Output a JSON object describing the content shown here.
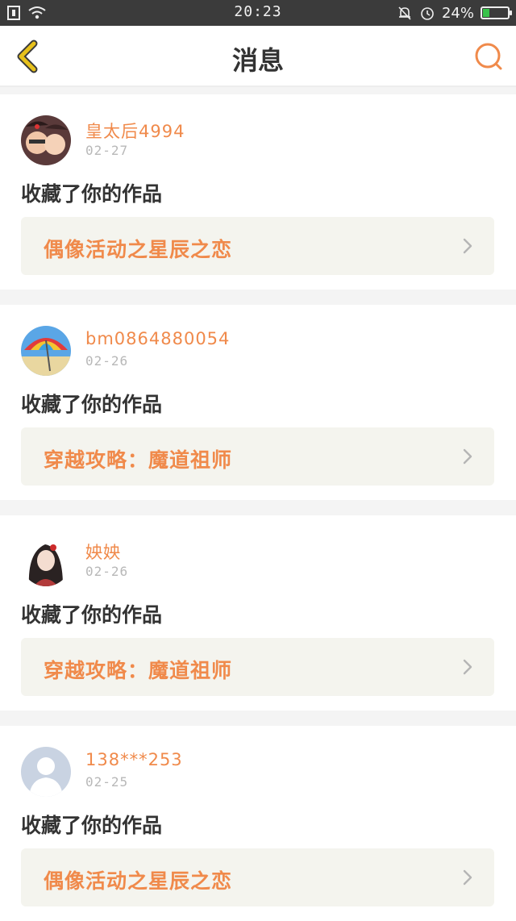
{
  "status_bar": {
    "time": "20:23",
    "battery_text": "24%",
    "battery_level": 0.24
  },
  "header": {
    "title": "消息",
    "back_icon": "chevron-left-icon",
    "search_icon": "search-icon"
  },
  "colors": {
    "accent": "#f08a4b",
    "back_icon": "#e7c11b",
    "card_bg": "#ffffff",
    "work_bg": "#f4f4ee",
    "page_bg": "#f4f4f4"
  },
  "messages": [
    {
      "username": "皇太后4994",
      "date": "02-27",
      "action": "收藏了你的作品",
      "work_title": "偶像活动之星辰之恋"
    },
    {
      "username": "bm0864880054",
      "date": "02-26",
      "action": "收藏了你的作品",
      "work_title": "穿越攻略：魔道祖师"
    },
    {
      "username": "姎姎",
      "date": "02-26",
      "action": "收藏了你的作品",
      "work_title": "穿越攻略：魔道祖师"
    },
    {
      "username": "138***253",
      "date": "02-25",
      "action": "收藏了你的作品",
      "work_title": "偶像活动之星辰之恋"
    }
  ]
}
